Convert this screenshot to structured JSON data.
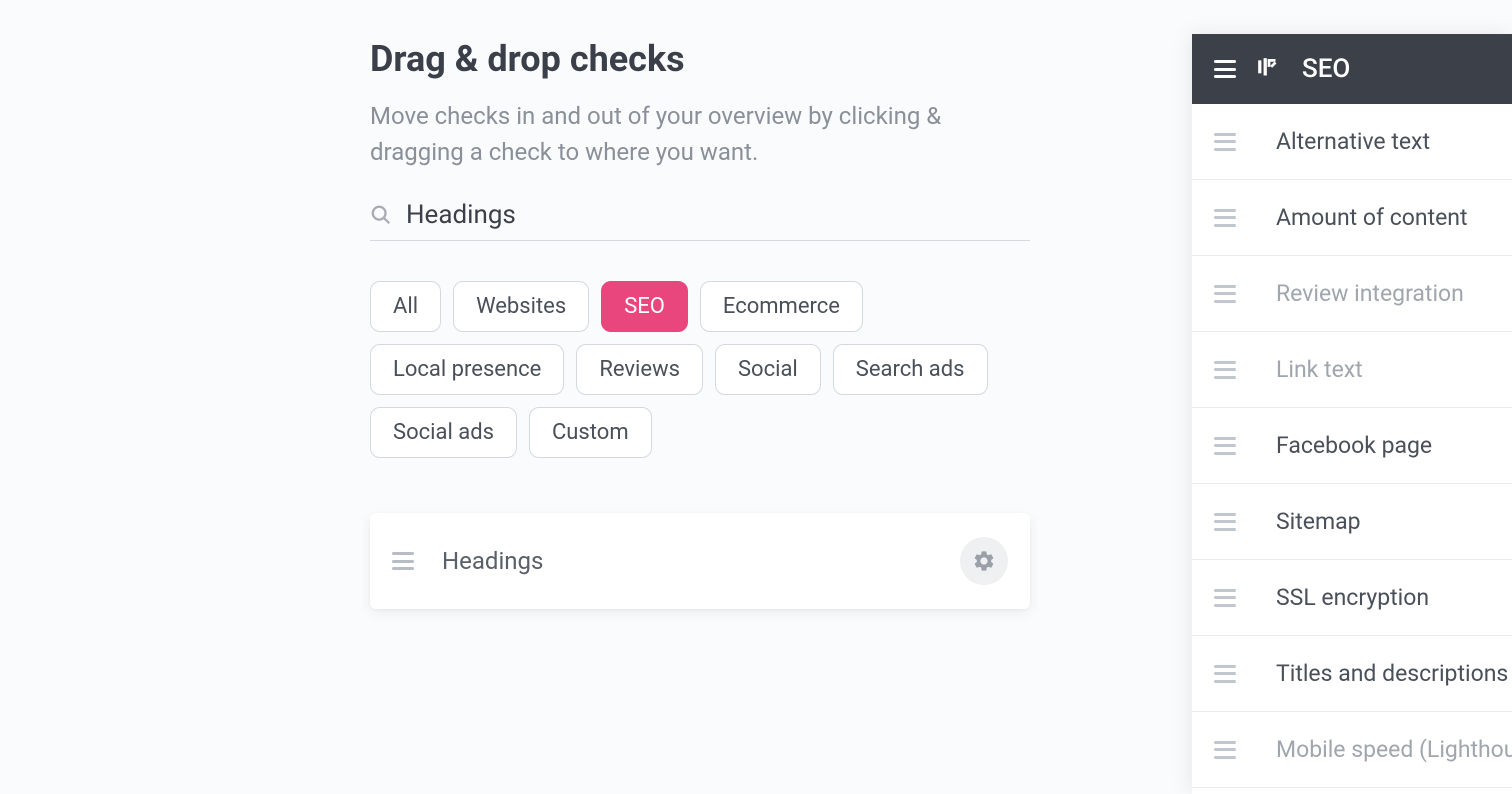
{
  "header": {
    "title": "Drag & drop checks",
    "subtitle": "Move checks in and out of your overview by clicking & dragging a check to where you want."
  },
  "search": {
    "value": "Headings"
  },
  "filters": [
    {
      "label": "All",
      "active": false
    },
    {
      "label": "Websites",
      "active": false
    },
    {
      "label": "SEO",
      "active": true
    },
    {
      "label": "Ecommerce",
      "active": false
    },
    {
      "label": "Local presence",
      "active": false
    },
    {
      "label": "Reviews",
      "active": false
    },
    {
      "label": "Social",
      "active": false
    },
    {
      "label": "Search ads",
      "active": false
    },
    {
      "label": "Social ads",
      "active": false
    },
    {
      "label": "Custom",
      "active": false
    }
  ],
  "results": [
    {
      "label": "Headings"
    }
  ],
  "sidebar": {
    "category_title": "SEO",
    "items": [
      {
        "label": "Alternative text",
        "muted": false
      },
      {
        "label": "Amount of content",
        "muted": false
      },
      {
        "label": "Review integration",
        "muted": true
      },
      {
        "label": "Link text",
        "muted": true
      },
      {
        "label": "Facebook page",
        "muted": false
      },
      {
        "label": "Sitemap",
        "muted": false
      },
      {
        "label": "SSL encryption",
        "muted": false
      },
      {
        "label": "Titles and descriptions",
        "muted": false
      },
      {
        "label": "Mobile speed (Lighthouse)",
        "muted": true
      }
    ]
  }
}
